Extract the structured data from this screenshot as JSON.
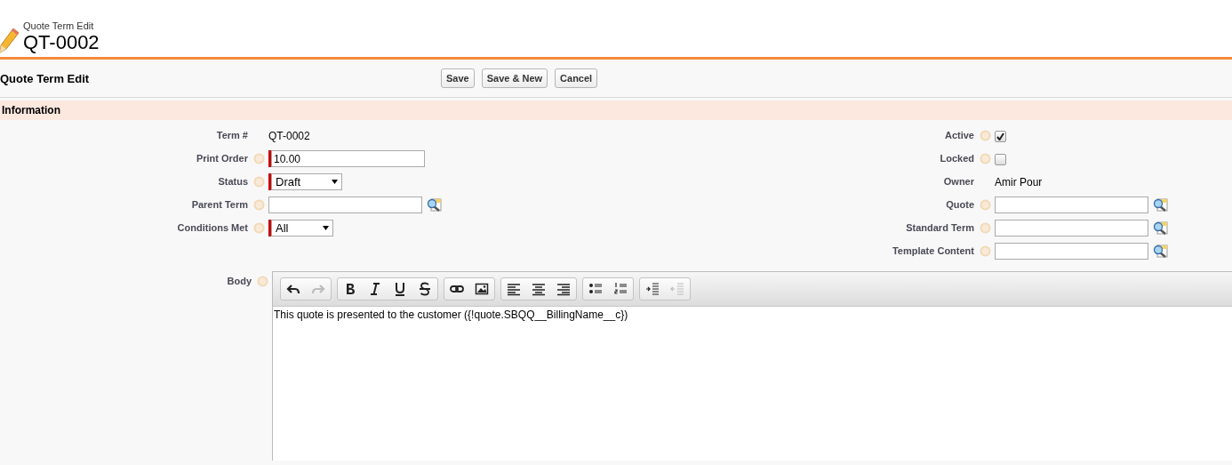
{
  "header": {
    "subtitle": "Quote Term Edit",
    "title": "QT-0002"
  },
  "button_bar": {
    "title": "Quote Term Edit",
    "buttons": [
      "Save",
      "Save & New",
      "Cancel"
    ]
  },
  "section": {
    "title": "Information"
  },
  "left_fields": [
    {
      "label": "Term #",
      "kind": "text",
      "value": "QT-0002",
      "help": false,
      "required": false
    },
    {
      "label": "Print Order",
      "kind": "input",
      "value": "10.00",
      "help": true,
      "required": true
    },
    {
      "label": "Status",
      "kind": "select",
      "value": "Draft",
      "help": true,
      "required": true
    },
    {
      "label": "Parent Term",
      "kind": "lookup",
      "help": true,
      "required": false
    },
    {
      "label": "Conditions Met",
      "kind": "select",
      "value": "All",
      "help": true,
      "required": true
    }
  ],
  "right_fields": [
    {
      "label": "Active",
      "kind": "checkbox",
      "checked": true,
      "help": true
    },
    {
      "label": "Locked",
      "kind": "checkbox",
      "checked": false,
      "help": true
    },
    {
      "label": "Owner",
      "kind": "text",
      "value": "Amir Pour",
      "help": false
    },
    {
      "label": "Quote",
      "kind": "lookup",
      "help": true
    },
    {
      "label": "Standard Term",
      "kind": "lookup",
      "help": true
    },
    {
      "label": "Template Content",
      "kind": "lookup",
      "help": true
    }
  ],
  "body": {
    "label": "Body",
    "help": true,
    "toolbar": [
      [
        {
          "kind": "undo",
          "disabled": false
        },
        {
          "kind": "redo",
          "disabled": true
        }
      ],
      [
        {
          "kind": "bold",
          "disabled": false
        },
        {
          "kind": "italic",
          "disabled": false
        },
        {
          "kind": "underline",
          "disabled": false
        },
        {
          "kind": "strikethrough",
          "disabled": false
        }
      ],
      [
        {
          "kind": "link",
          "disabled": false
        },
        {
          "kind": "image",
          "disabled": false
        }
      ],
      [
        {
          "kind": "align-left",
          "disabled": false
        },
        {
          "kind": "align-center",
          "disabled": false
        },
        {
          "kind": "align-right",
          "disabled": false
        }
      ],
      [
        {
          "kind": "bullet-list",
          "disabled": false
        },
        {
          "kind": "numbered-list",
          "disabled": false
        }
      ],
      [
        {
          "kind": "indent",
          "disabled": false
        },
        {
          "kind": "outdent",
          "disabled": true
        }
      ]
    ],
    "text": "This quote is presented to the customer  ({!quote.SBQQ__BillingName__c})"
  }
}
